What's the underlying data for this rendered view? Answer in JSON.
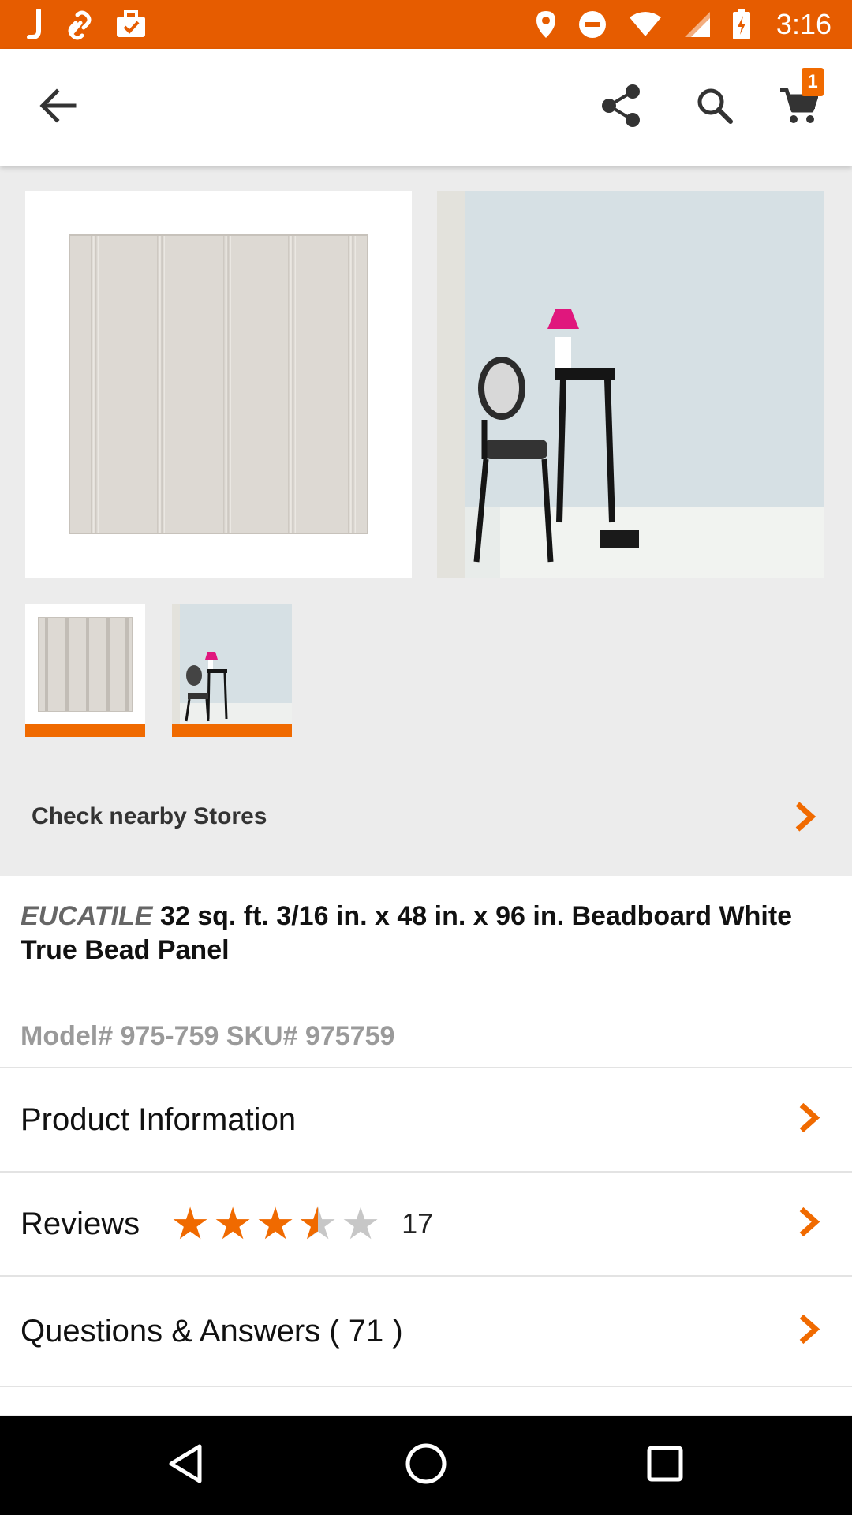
{
  "status_bar": {
    "time": "3:16",
    "left_icons": [
      "j-app-icon",
      "link-icon",
      "briefcase-check-icon"
    ],
    "right_icons": [
      "location-icon",
      "do-not-disturb-icon",
      "wifi-icon",
      "signal-icon",
      "battery-charging-icon"
    ]
  },
  "app_bar": {
    "cart_count": "1",
    "icons": [
      "back-arrow-icon",
      "share-icon",
      "search-icon",
      "cart-icon"
    ]
  },
  "gallery": {
    "images": [
      "beadboard-panel-image",
      "room-scene-image"
    ],
    "thumbnails": [
      "beadboard-panel-thumbnail",
      "room-scene-thumbnail"
    ],
    "accent_color": "#f06a00"
  },
  "nearby": {
    "label": "Check nearby Stores"
  },
  "product": {
    "brand": "EUCATILE",
    "title": "32 sq. ft. 3/16 in. x 48 in. x 96 in. Beadboard White True Bead Panel",
    "model_sku": "Model# 975-759 SKU# 975759"
  },
  "sections": {
    "product_info": "Product Information",
    "reviews": "Reviews",
    "review_count": "17",
    "rating": 3.5,
    "rating_max": 5,
    "qa": "Questions & Answers ( 71 )"
  },
  "colors": {
    "brand_orange": "#e65c00",
    "accent_orange": "#f06a00"
  }
}
